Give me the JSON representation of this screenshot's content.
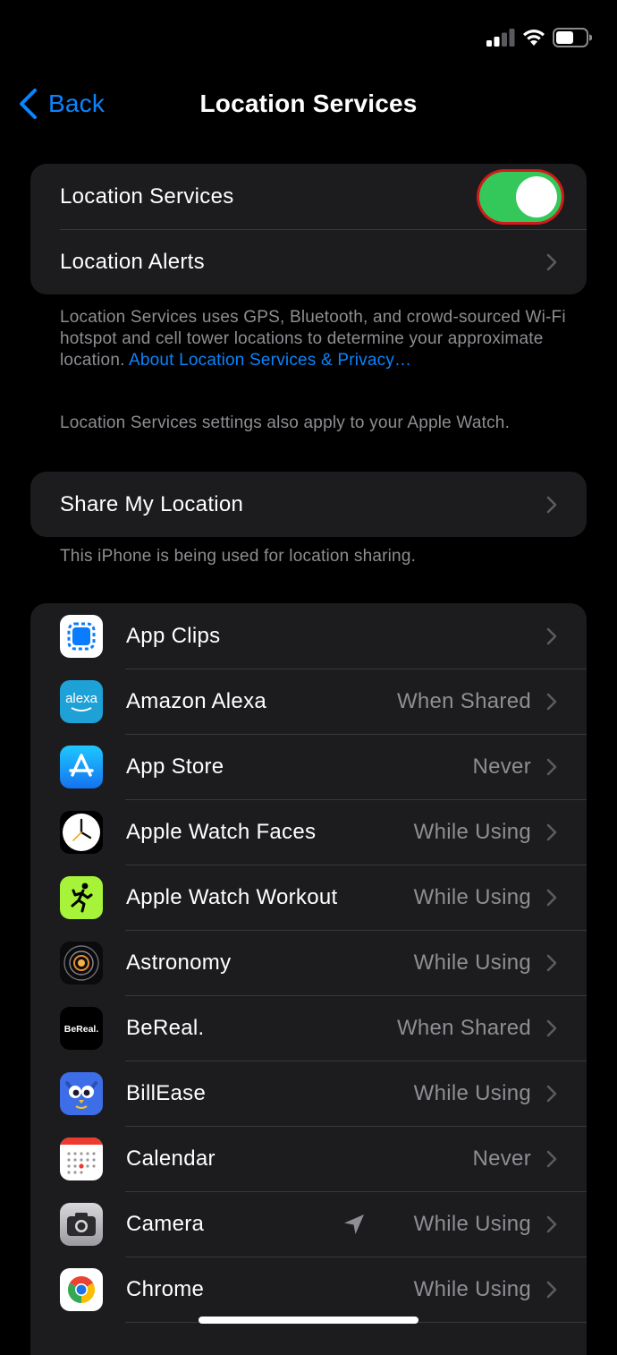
{
  "nav": {
    "back_label": "Back",
    "title": "Location Services"
  },
  "main_group": {
    "location_services_label": "Location Services",
    "location_services_on": true,
    "location_alerts_label": "Location Alerts"
  },
  "description": {
    "text": "Location Services uses GPS, Bluetooth, and crowd-sourced Wi-Fi hotspot and cell tower locations to determine your approximate location. ",
    "link": "About Location Services & Privacy…",
    "watch_note": "Location Services settings also apply to your Apple Watch."
  },
  "share_group": {
    "label": "Share My Location",
    "footer": "This iPhone is being used for location sharing."
  },
  "apps": [
    {
      "name": "App Clips",
      "value": "",
      "icon": "app-clips-icon"
    },
    {
      "name": "Amazon Alexa",
      "value": "When Shared",
      "icon": "alexa-icon"
    },
    {
      "name": "App Store",
      "value": "Never",
      "icon": "app-store-icon"
    },
    {
      "name": "Apple Watch Faces",
      "value": "While Using",
      "icon": "watch-faces-icon"
    },
    {
      "name": "Apple Watch Workout",
      "value": "While Using",
      "icon": "workout-icon"
    },
    {
      "name": "Astronomy",
      "value": "While Using",
      "icon": "astronomy-icon"
    },
    {
      "name": "BeReal.",
      "value": "When Shared",
      "icon": "bereal-icon"
    },
    {
      "name": "BillEase",
      "value": "While Using",
      "icon": "billease-icon"
    },
    {
      "name": "Calendar",
      "value": "Never",
      "icon": "calendar-icon"
    },
    {
      "name": "Camera",
      "value": "While Using",
      "icon": "camera-icon",
      "recent_use": true
    },
    {
      "name": "Chrome",
      "value": "While Using",
      "icon": "chrome-icon"
    }
  ],
  "icon_text": {
    "alexa": "alexa",
    "bereal": "BeReal."
  },
  "colors": {
    "accent": "#0a84ff",
    "toggle_on": "#34c759",
    "highlight": "#d11a1a",
    "cell_bg": "#1c1c1e",
    "secondary_text": "#8e8e93"
  }
}
